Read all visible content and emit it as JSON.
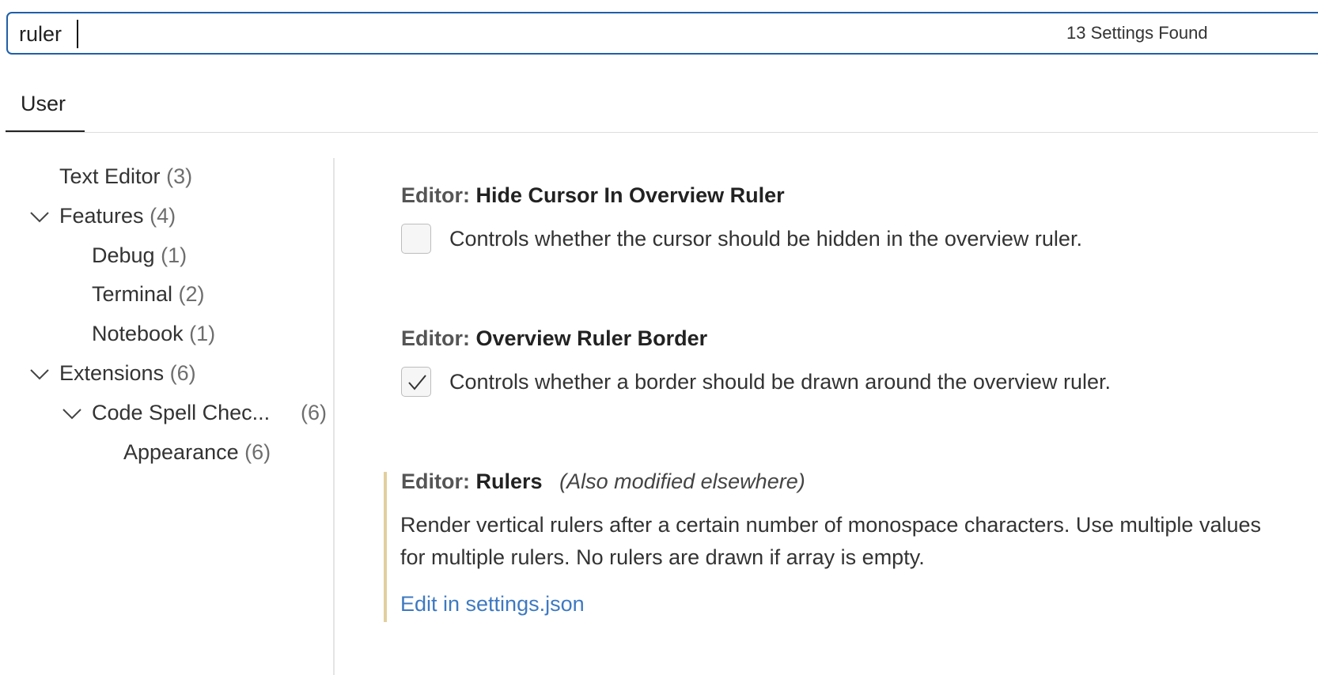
{
  "search": {
    "value": "ruler",
    "result_count": "13 Settings Found"
  },
  "tabs": [
    {
      "label": "User"
    }
  ],
  "sidebar": {
    "items": [
      {
        "label": "Text Editor",
        "count": "(3)"
      },
      {
        "label": "Features",
        "count": "(4)"
      },
      {
        "label": "Debug",
        "count": "(1)"
      },
      {
        "label": "Terminal",
        "count": "(2)"
      },
      {
        "label": "Notebook",
        "count": "(1)"
      },
      {
        "label": "Extensions",
        "count": "(6)"
      },
      {
        "label": "Code Spell Chec...",
        "count": "(6)"
      },
      {
        "label": "Appearance",
        "count": "(6)"
      }
    ]
  },
  "settings": [
    {
      "category": "Editor:",
      "name": "Hide Cursor In Overview Ruler",
      "description": "Controls whether the cursor should be hidden in the overview ruler.",
      "checked": false
    },
    {
      "category": "Editor:",
      "name": "Overview Ruler Border",
      "description": "Controls whether a border should be drawn around the overview ruler.",
      "checked": true
    },
    {
      "category": "Editor:",
      "name": "Rulers",
      "modified_note": "(Also modified elsewhere)",
      "description": "Render vertical rulers after a certain number of monospace characters. Use multiple values for multiple rulers. No rulers are drawn if array is empty.",
      "link": "Edit in settings.json"
    }
  ],
  "colors": {
    "focus_border": "#1f5fa8",
    "link": "#3e79c1",
    "modified_indicator": "#e2cf9e"
  }
}
